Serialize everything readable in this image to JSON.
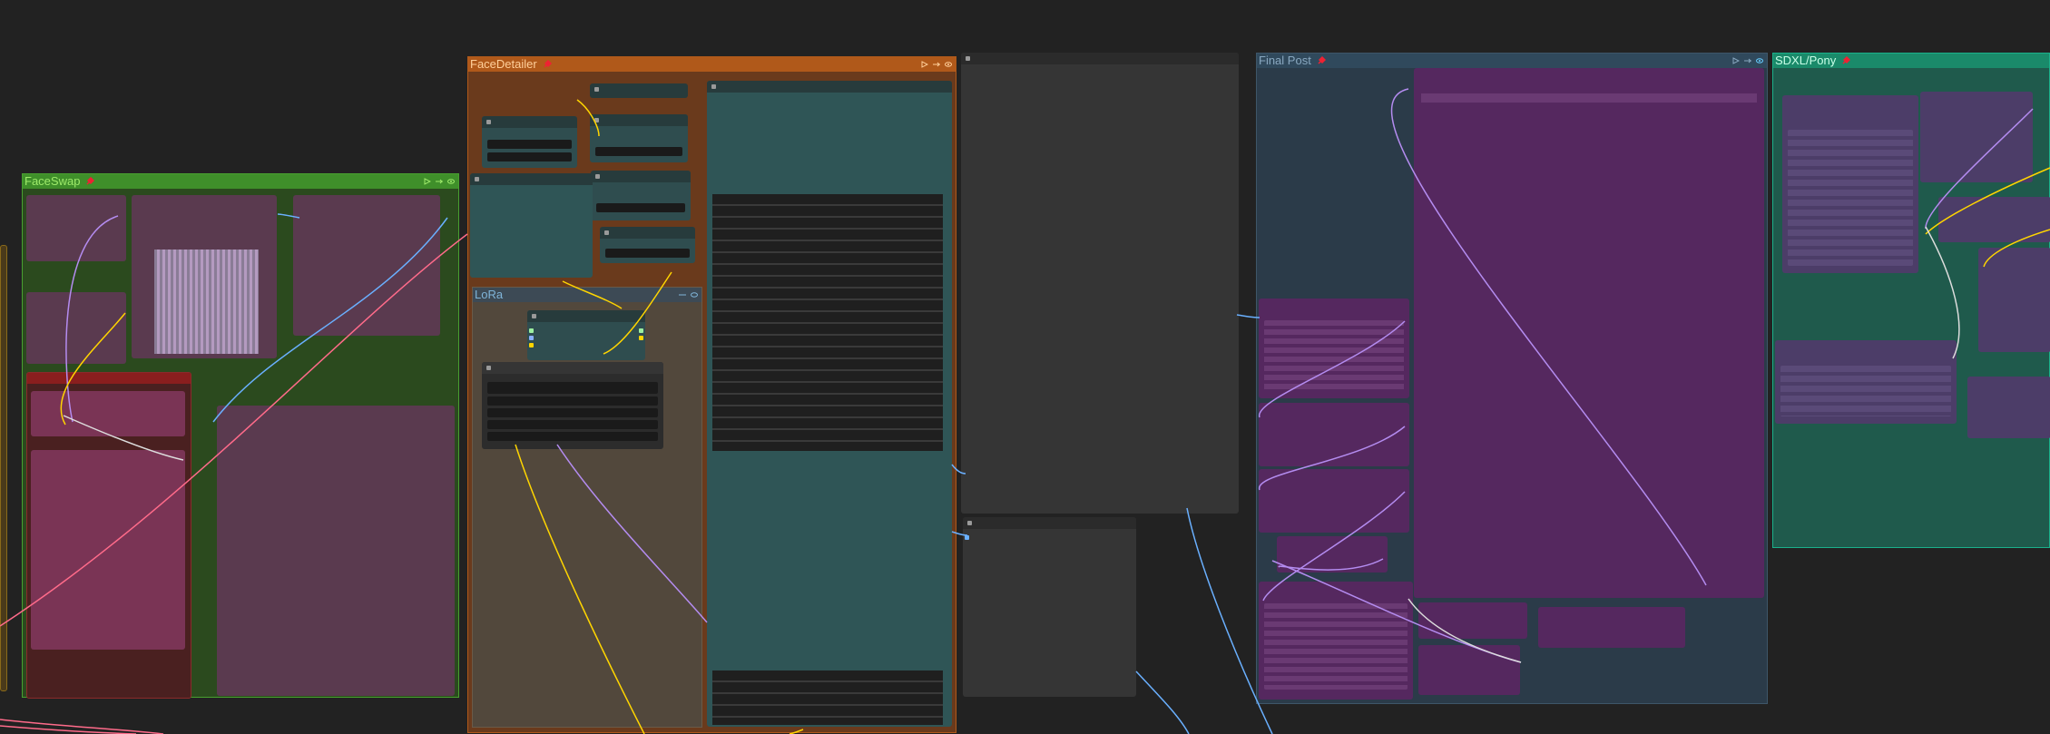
{
  "canvas": {
    "background": "#222222"
  },
  "groups": {
    "faceswap": {
      "title": "FaceSwap",
      "color": "#3f8f2a"
    },
    "facedetailer": {
      "title": "FaceDetailer",
      "color": "#b0591a"
    },
    "lora": {
      "title": "LoRa",
      "color": "#52483c"
    },
    "finalpost": {
      "title": "Final Post",
      "color": "#2b3b49"
    },
    "sdxlpony": {
      "title": "SDXL/Pony",
      "color": "#1a8a6a"
    }
  },
  "icons": {
    "pin": "pin-icon",
    "play": "play-icon",
    "link": "link-icon",
    "eye": "eye-icon"
  },
  "colors": {
    "wire_yellow": "#ffd500",
    "wire_purple": "#b48cf0",
    "wire_blue": "#6ab0ff",
    "wire_pink": "#ff6b8a",
    "wire_white": "#dddddd",
    "node_teal": "#335a5c",
    "node_dark": "#353535",
    "node_purple": "#4e2a63",
    "node_pink": "#6a3a55"
  }
}
